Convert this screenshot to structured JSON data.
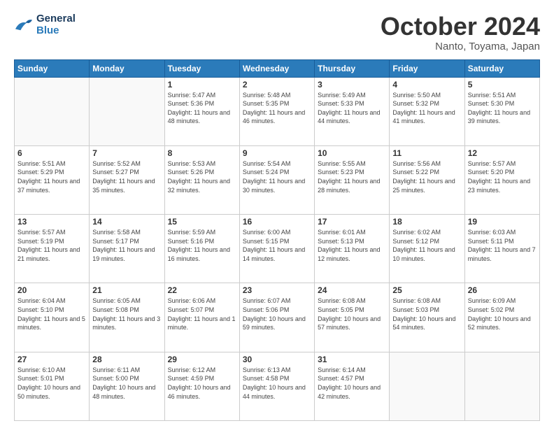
{
  "header": {
    "logo_line1": "General",
    "logo_line2": "Blue",
    "month": "October 2024",
    "location": "Nanto, Toyama, Japan"
  },
  "weekdays": [
    "Sunday",
    "Monday",
    "Tuesday",
    "Wednesday",
    "Thursday",
    "Friday",
    "Saturday"
  ],
  "weeks": [
    [
      {
        "day": "",
        "info": ""
      },
      {
        "day": "",
        "info": ""
      },
      {
        "day": "1",
        "info": "Sunrise: 5:47 AM\nSunset: 5:36 PM\nDaylight: 11 hours and 48 minutes."
      },
      {
        "day": "2",
        "info": "Sunrise: 5:48 AM\nSunset: 5:35 PM\nDaylight: 11 hours and 46 minutes."
      },
      {
        "day": "3",
        "info": "Sunrise: 5:49 AM\nSunset: 5:33 PM\nDaylight: 11 hours and 44 minutes."
      },
      {
        "day": "4",
        "info": "Sunrise: 5:50 AM\nSunset: 5:32 PM\nDaylight: 11 hours and 41 minutes."
      },
      {
        "day": "5",
        "info": "Sunrise: 5:51 AM\nSunset: 5:30 PM\nDaylight: 11 hours and 39 minutes."
      }
    ],
    [
      {
        "day": "6",
        "info": "Sunrise: 5:51 AM\nSunset: 5:29 PM\nDaylight: 11 hours and 37 minutes."
      },
      {
        "day": "7",
        "info": "Sunrise: 5:52 AM\nSunset: 5:27 PM\nDaylight: 11 hours and 35 minutes."
      },
      {
        "day": "8",
        "info": "Sunrise: 5:53 AM\nSunset: 5:26 PM\nDaylight: 11 hours and 32 minutes."
      },
      {
        "day": "9",
        "info": "Sunrise: 5:54 AM\nSunset: 5:24 PM\nDaylight: 11 hours and 30 minutes."
      },
      {
        "day": "10",
        "info": "Sunrise: 5:55 AM\nSunset: 5:23 PM\nDaylight: 11 hours and 28 minutes."
      },
      {
        "day": "11",
        "info": "Sunrise: 5:56 AM\nSunset: 5:22 PM\nDaylight: 11 hours and 25 minutes."
      },
      {
        "day": "12",
        "info": "Sunrise: 5:57 AM\nSunset: 5:20 PM\nDaylight: 11 hours and 23 minutes."
      }
    ],
    [
      {
        "day": "13",
        "info": "Sunrise: 5:57 AM\nSunset: 5:19 PM\nDaylight: 11 hours and 21 minutes."
      },
      {
        "day": "14",
        "info": "Sunrise: 5:58 AM\nSunset: 5:17 PM\nDaylight: 11 hours and 19 minutes."
      },
      {
        "day": "15",
        "info": "Sunrise: 5:59 AM\nSunset: 5:16 PM\nDaylight: 11 hours and 16 minutes."
      },
      {
        "day": "16",
        "info": "Sunrise: 6:00 AM\nSunset: 5:15 PM\nDaylight: 11 hours and 14 minutes."
      },
      {
        "day": "17",
        "info": "Sunrise: 6:01 AM\nSunset: 5:13 PM\nDaylight: 11 hours and 12 minutes."
      },
      {
        "day": "18",
        "info": "Sunrise: 6:02 AM\nSunset: 5:12 PM\nDaylight: 11 hours and 10 minutes."
      },
      {
        "day": "19",
        "info": "Sunrise: 6:03 AM\nSunset: 5:11 PM\nDaylight: 11 hours and 7 minutes."
      }
    ],
    [
      {
        "day": "20",
        "info": "Sunrise: 6:04 AM\nSunset: 5:10 PM\nDaylight: 11 hours and 5 minutes."
      },
      {
        "day": "21",
        "info": "Sunrise: 6:05 AM\nSunset: 5:08 PM\nDaylight: 11 hours and 3 minutes."
      },
      {
        "day": "22",
        "info": "Sunrise: 6:06 AM\nSunset: 5:07 PM\nDaylight: 11 hours and 1 minute."
      },
      {
        "day": "23",
        "info": "Sunrise: 6:07 AM\nSunset: 5:06 PM\nDaylight: 10 hours and 59 minutes."
      },
      {
        "day": "24",
        "info": "Sunrise: 6:08 AM\nSunset: 5:05 PM\nDaylight: 10 hours and 57 minutes."
      },
      {
        "day": "25",
        "info": "Sunrise: 6:08 AM\nSunset: 5:03 PM\nDaylight: 10 hours and 54 minutes."
      },
      {
        "day": "26",
        "info": "Sunrise: 6:09 AM\nSunset: 5:02 PM\nDaylight: 10 hours and 52 minutes."
      }
    ],
    [
      {
        "day": "27",
        "info": "Sunrise: 6:10 AM\nSunset: 5:01 PM\nDaylight: 10 hours and 50 minutes."
      },
      {
        "day": "28",
        "info": "Sunrise: 6:11 AM\nSunset: 5:00 PM\nDaylight: 10 hours and 48 minutes."
      },
      {
        "day": "29",
        "info": "Sunrise: 6:12 AM\nSunset: 4:59 PM\nDaylight: 10 hours and 46 minutes."
      },
      {
        "day": "30",
        "info": "Sunrise: 6:13 AM\nSunset: 4:58 PM\nDaylight: 10 hours and 44 minutes."
      },
      {
        "day": "31",
        "info": "Sunrise: 6:14 AM\nSunset: 4:57 PM\nDaylight: 10 hours and 42 minutes."
      },
      {
        "day": "",
        "info": ""
      },
      {
        "day": "",
        "info": ""
      }
    ]
  ]
}
